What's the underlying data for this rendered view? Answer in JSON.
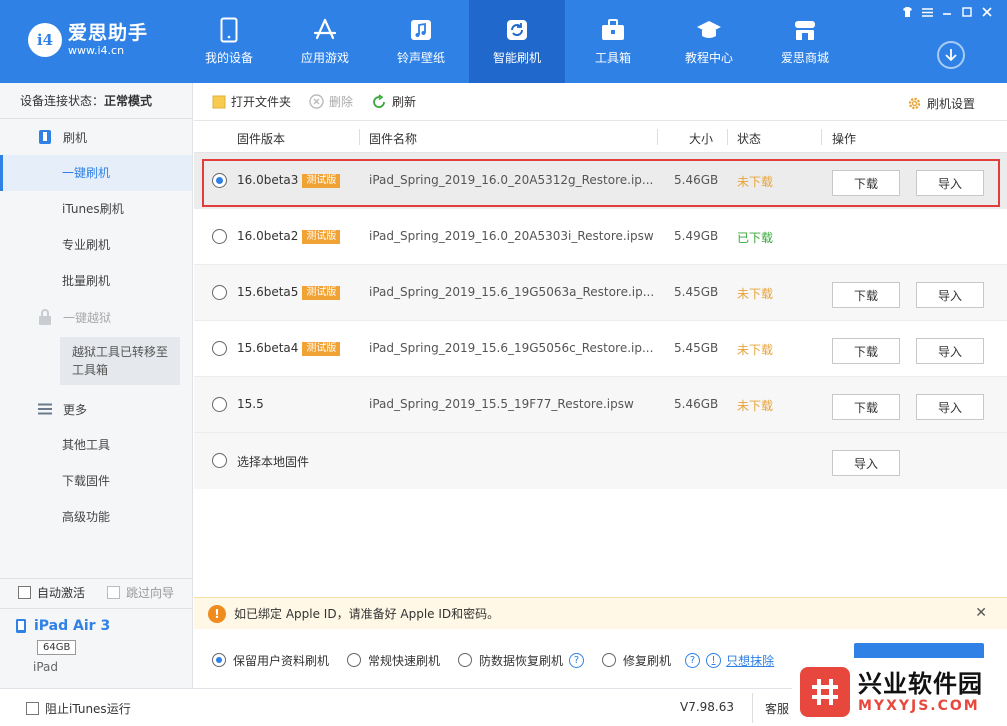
{
  "brand": {
    "name": "爱思助手",
    "url": "www.i4.cn",
    "badge": "i4"
  },
  "nav": [
    {
      "label": "我的设备",
      "icon": "phone-icon"
    },
    {
      "label": "应用游戏",
      "icon": "app-store-icon"
    },
    {
      "label": "铃声壁纸",
      "icon": "music-icon"
    },
    {
      "label": "智能刷机",
      "icon": "refresh-icon",
      "active": true
    },
    {
      "label": "工具箱",
      "icon": "toolbox-icon"
    },
    {
      "label": "教程中心",
      "icon": "graduation-cap-icon"
    },
    {
      "label": "爱思商城",
      "icon": "store-icon"
    }
  ],
  "sidebar": {
    "status_label": "设备连接状态：",
    "status_value": "正常模式",
    "flash_group": "刷机",
    "items": [
      "一键刷机",
      "iTunes刷机",
      "专业刷机",
      "批量刷机"
    ],
    "jailbreak_group": "一键越狱",
    "jailbreak_note": "越狱工具已转移至工具箱",
    "more_group": "更多",
    "more_items": [
      "其他工具",
      "下载固件",
      "高级功能"
    ],
    "auto_activate": "自动激活",
    "skip_guide": "跳过向导"
  },
  "device": {
    "name": "iPad Air 3",
    "capacity": "64GB",
    "type": "iPad"
  },
  "toolbar": {
    "open_folder": "打开文件夹",
    "delete": "删除",
    "refresh": "刷新",
    "settings": "刷机设置"
  },
  "table": {
    "headers": {
      "version": "固件版本",
      "name": "固件名称",
      "size": "大小",
      "status": "状态",
      "action": "操作"
    },
    "beta_tag": "测试版",
    "download": "下载",
    "import": "导入",
    "rows": [
      {
        "version": "16.0beta3",
        "beta": true,
        "name": "iPad_Spring_2019_16.0_20A5312g_Restore.ip...",
        "size": "5.46GB",
        "status": "未下载",
        "downloaded": false,
        "selected": true
      },
      {
        "version": "16.0beta2",
        "beta": true,
        "name": "iPad_Spring_2019_16.0_20A5303i_Restore.ipsw",
        "size": "5.49GB",
        "status": "已下载",
        "downloaded": true,
        "selected": false
      },
      {
        "version": "15.6beta5",
        "beta": true,
        "name": "iPad_Spring_2019_15.6_19G5063a_Restore.ip...",
        "size": "5.45GB",
        "status": "未下载",
        "downloaded": false,
        "selected": false
      },
      {
        "version": "15.6beta4",
        "beta": true,
        "name": "iPad_Spring_2019_15.6_19G5056c_Restore.ip...",
        "size": "5.45GB",
        "status": "未下载",
        "downloaded": false,
        "selected": false
      },
      {
        "version": "15.5",
        "beta": false,
        "name": "iPad_Spring_2019_15.5_19F77_Restore.ipsw",
        "size": "5.46GB",
        "status": "未下载",
        "downloaded": false,
        "selected": false
      }
    ],
    "local": "选择本地固件"
  },
  "notice": {
    "icon": "!",
    "text": "如已绑定 Apple ID，请准备好 Apple ID和密码。"
  },
  "options": {
    "keep_data": "保留用户资料刷机",
    "normal_fast": "常规快速刷机",
    "anti_data_loss": "防数据恢复刷机",
    "repair": "修复刷机",
    "link": "只想抹除",
    "help": "?"
  },
  "statusbar": {
    "block_itunes": "阻止iTunes运行",
    "version": "V7.98.63",
    "service": "客服"
  },
  "watermark": {
    "cn": "兴业软件园",
    "en": "MYXYJS.COM"
  }
}
